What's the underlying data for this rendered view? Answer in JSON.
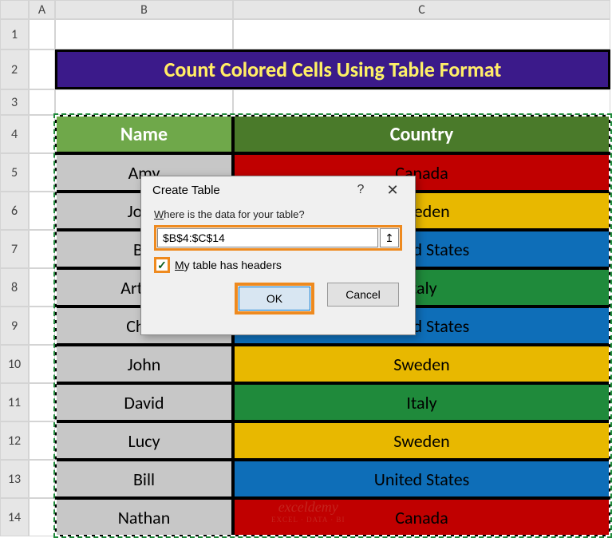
{
  "columns": {
    "A": "A",
    "B": "B",
    "C": "C"
  },
  "rows": {
    "r1": "1",
    "r2": "2",
    "r3": "3",
    "r4": "4",
    "r5": "5",
    "r6": "6",
    "r7": "7",
    "r8": "8",
    "r9": "9",
    "r10": "10",
    "r11": "11",
    "r12": "12",
    "r13": "13",
    "r14": "14"
  },
  "title": "Count Colored Cells Using Table Format",
  "table": {
    "headers": {
      "name": "Name",
      "country": "Country"
    },
    "rows": [
      {
        "name": "Amy",
        "country": "Canada",
        "name_bg": "gray-bg",
        "country_bg": "red-bg"
      },
      {
        "name": "John",
        "country": "Sweden",
        "name_bg": "gray-bg",
        "country_bg": "yellow-bg"
      },
      {
        "name": "Bill",
        "country": "United States",
        "name_bg": "gray-bg",
        "country_bg": "blue-bg"
      },
      {
        "name": "Arthur",
        "country": "Italy",
        "name_bg": "gray-bg",
        "country_bg": "green-bg"
      },
      {
        "name": "Chris",
        "country": "United States",
        "name_bg": "gray-bg",
        "country_bg": "blue-bg"
      },
      {
        "name": "John",
        "country": "Sweden",
        "name_bg": "gray-bg",
        "country_bg": "yellow-bg"
      },
      {
        "name": "David",
        "country": "Italy",
        "name_bg": "gray-bg",
        "country_bg": "green-bg"
      },
      {
        "name": "Lucy",
        "country": "Sweden",
        "name_bg": "gray-bg",
        "country_bg": "yellow-bg"
      },
      {
        "name": "Bill",
        "country": "United States",
        "name_bg": "gray-bg",
        "country_bg": "blue-bg"
      },
      {
        "name": "Nathan",
        "country": "Canada",
        "name_bg": "gray-bg",
        "country_bg": "red-bg"
      }
    ]
  },
  "dialog": {
    "title": "Create Table",
    "help": "?",
    "close": "✕",
    "prompt_pre": "W",
    "prompt_rest": "here is the data for your table?",
    "range": "$B$4:$C$14",
    "ref_icon": "↥",
    "check_mark": "✓",
    "check_pre": "M",
    "check_rest": "y table has headers",
    "ok": "OK",
    "cancel": "Cancel"
  },
  "watermark": {
    "main": "exceldemy",
    "sub": "EXCEL · DATA · BI"
  }
}
